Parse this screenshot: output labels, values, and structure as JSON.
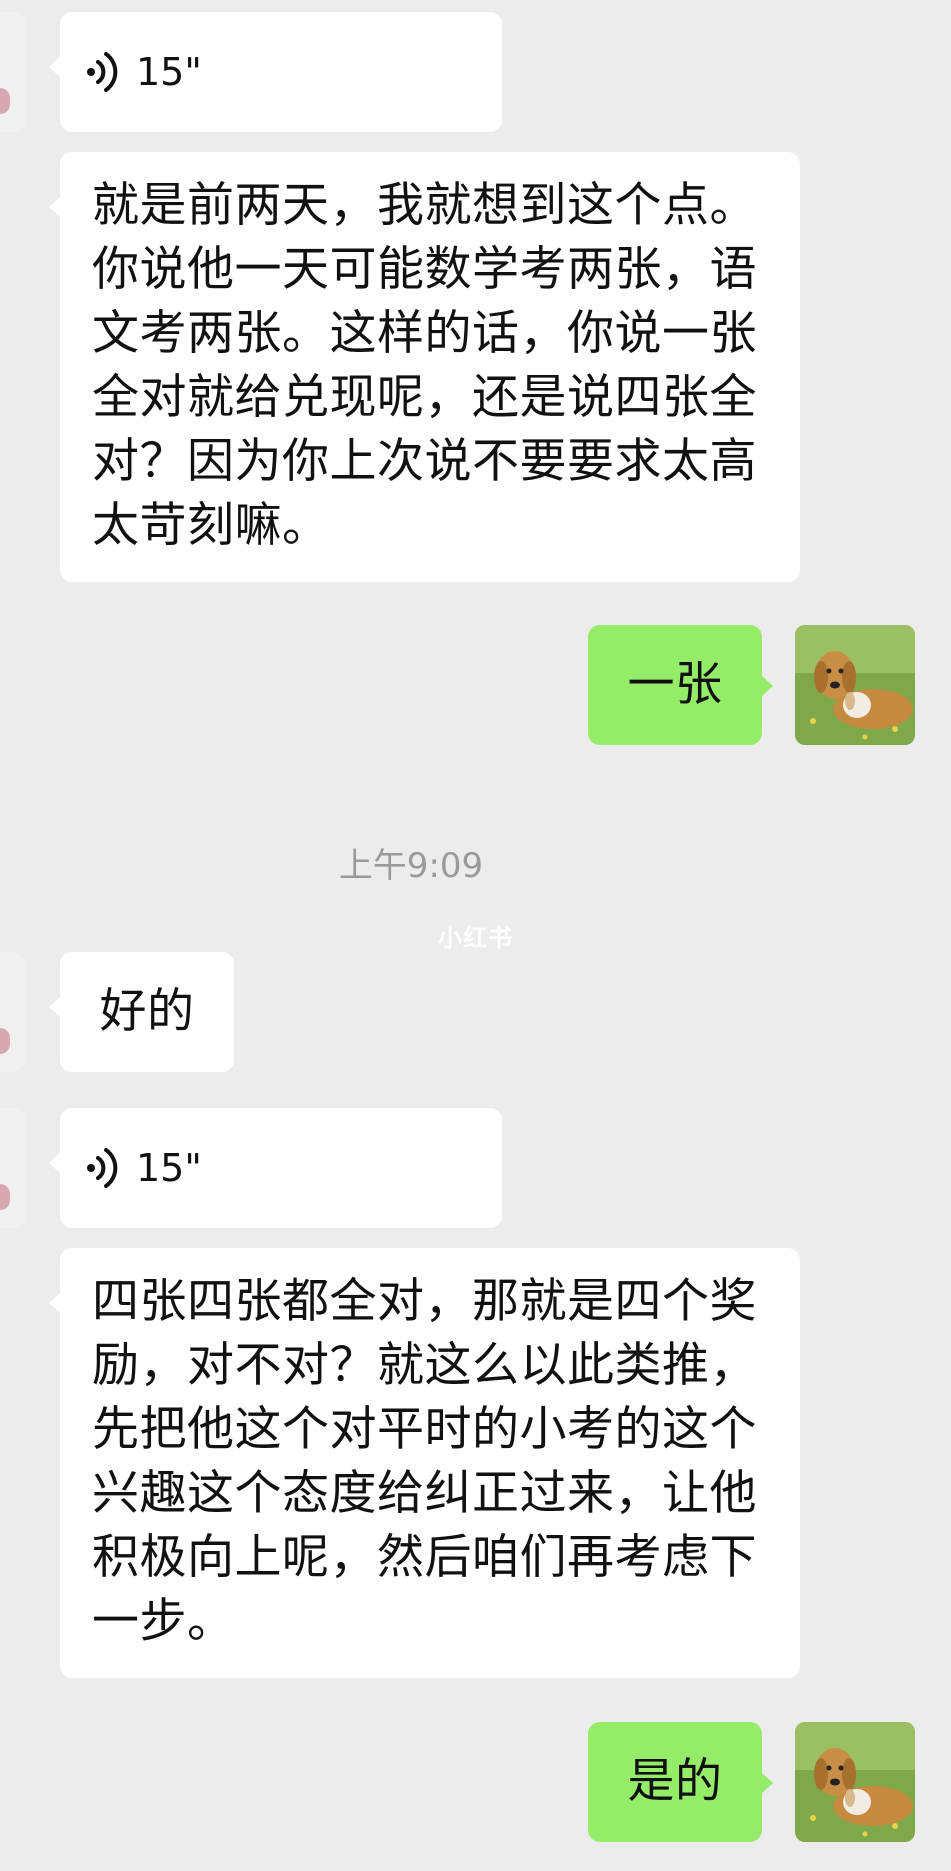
{
  "messages": [
    {
      "type": "voice",
      "side": "left",
      "duration": "15\""
    },
    {
      "type": "text",
      "side": "left",
      "text": "就是前两天，我就想到这个点。你说他一天可能数学考两张，语文考两张。这样的话，你说一张全对就给兑现呢，还是说四张全对？因为你上次说不要要求太高太苛刻嘛。"
    },
    {
      "type": "text",
      "side": "right",
      "text": "一张"
    },
    {
      "type": "time",
      "text": "上午9:09"
    },
    {
      "type": "text",
      "side": "left",
      "text": "好的"
    },
    {
      "type": "voice",
      "side": "left",
      "duration": "15\""
    },
    {
      "type": "text",
      "side": "left",
      "text": "四张四张都全对，那就是四个奖励，对不对？就这么以此类推，先把他这个对平时的小考的这个兴趣这个态度给纠正过来，让他积极向上呢，然后咱们再考虑下一步。"
    },
    {
      "type": "text",
      "side": "right",
      "text": "是的"
    }
  ],
  "watermark": "小红书",
  "icons": {
    "voice": "voice-wave-icon",
    "self_avatar": "dog-photo-avatar"
  },
  "colors": {
    "background": "#ececec",
    "incoming_bubble": "#ffffff",
    "outgoing_bubble": "#95ec69",
    "timestamp": "#9a9a9a"
  }
}
